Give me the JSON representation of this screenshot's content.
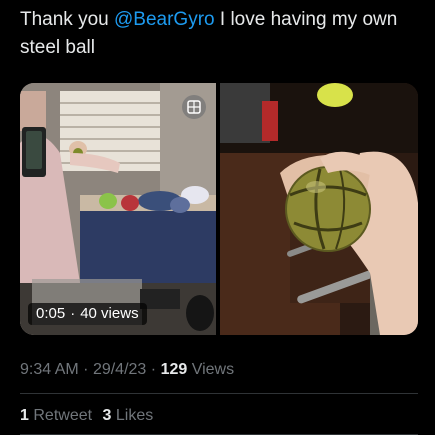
{
  "tweet": {
    "text_prefix": "Thank you ",
    "mention": "@BearGyro",
    "text_suffix": " I love having my own steel ball"
  },
  "video": {
    "duration": "0:05",
    "views_label": "40 views"
  },
  "meta": {
    "time": "9:34 AM",
    "date": "29/4/23",
    "separator": "·",
    "views_count": "129",
    "views_label": "Views"
  },
  "stats": {
    "retweets_count": "1",
    "retweets_label": "Retweet",
    "likes_count": "3",
    "likes_label": "Likes"
  },
  "colors": {
    "background": "#000000",
    "text": "#e7e9ea",
    "muted": "#71767b",
    "link": "#1d9bf0",
    "divider": "#2f3336"
  },
  "icons": {
    "gif_badge": "gif-icon"
  }
}
